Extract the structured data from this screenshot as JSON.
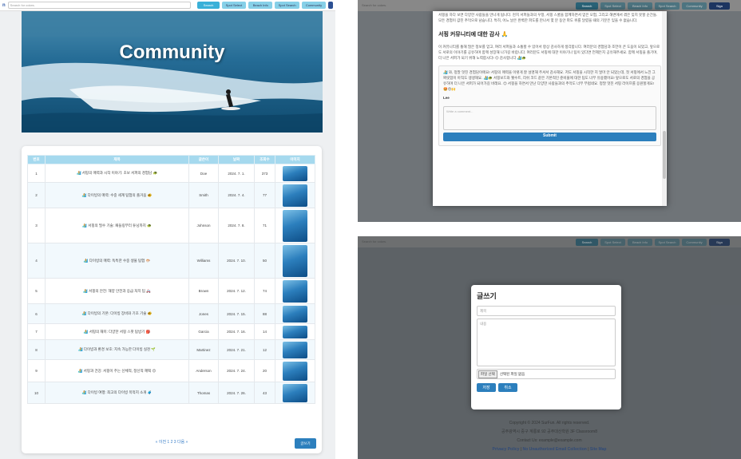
{
  "nav": {
    "brand": "n",
    "search_placeholder": "Search for cokes.",
    "buttons": [
      "Search",
      "Spot Select",
      "Beach Info",
      "Spot Search",
      "Community",
      "Sign"
    ]
  },
  "hero": {
    "title": "Community"
  },
  "table": {
    "headers": [
      "번호",
      "제목",
      "글쓴이",
      "날짜",
      "조회수",
      "이미지"
    ],
    "rows": [
      {
        "no": "1",
        "title": "🏄 서핑의 매력과 시작 이야기: 초보 서퍼의 경험담 🐢",
        "author": "Doe",
        "date": "2024. 7. 1.",
        "views": "373"
      },
      {
        "no": "2",
        "title": "🏄 다이빙의 매력: 수중 세계 탐험의 즐거움 🐠",
        "author": "Smith",
        "date": "2024. 7. 4.",
        "views": "77"
      },
      {
        "no": "3",
        "title": "🏄 서핑의 필수 기술: 패들링부터 튜닝까지 🐢",
        "author": "Johnson",
        "date": "2024. 7. 8.",
        "views": "71"
      },
      {
        "no": "4",
        "title": "🏄 다이빙의 매력: 독특한 수중 생물 탐험 🐡",
        "author": "Williams",
        "date": "2024. 7. 10.",
        "views": "50"
      },
      {
        "no": "5",
        "title": "🏄 서핑의 안전: 해양 안전과 응급 처치 팁 🚑",
        "author": "Brown",
        "date": "2024. 7. 12.",
        "views": "74"
      },
      {
        "no": "6",
        "title": "🏄 다이빙의 기본: 다이빙 장비와 기초 기술 🐠",
        "author": "Jones",
        "date": "2024. 7. 15.",
        "views": "88"
      },
      {
        "no": "7",
        "title": "🏄 서핑의 재미: 다양한 서핑 스팟 탐방기 🎒",
        "author": "Garcia",
        "date": "2024. 7. 16.",
        "views": "14"
      },
      {
        "no": "8",
        "title": "🏄 다이빙과 환경 보호: 지속 가능한 다이빙 실천 🌱",
        "author": "Martinez",
        "date": "2024. 7. 21.",
        "views": "12"
      },
      {
        "no": "9",
        "title": "🏄 서핑과 건강: 서핑이 주는 신체적, 정신적 혜택 😊",
        "author": "Anderson",
        "date": "2024. 7. 24.",
        "views": "20"
      },
      {
        "no": "10",
        "title": "🏄 다이빙 여행: 최고의 다이빙 목적지 소개 🧳",
        "author": "Thomas",
        "date": "2024. 7. 26.",
        "views": "43"
      }
    ]
  },
  "pager": {
    "text": "« 이전  1  2  3  다음 »"
  },
  "write_button": "글쓰기",
  "detail": {
    "intro": "서핑을 하다 보면 다양한 사람들을 만나게 됩니다. 현지 서퍼들과의 우정, 서핑 스쿨을 함께하면서 얻은 모험, 그리고 해변에서 겪은 잊지 못할 순간들. 모든 경험이 값진 추억으로 남습니다. 특히, 어느 날은 완벽한 파도를 만나서 몇 분 동안 파도 위를 달렸을 때의 기분은 잊을 수 없습니다.",
    "heading": "서핑 커뮤니티에 대한 감사 🙏",
    "para": "이 커뮤니티를 통해 많은 정보를 얻고, 여러 서퍼들과 소통할 수 있어서 항상 감사하게 생각합니다. 여러분의 경험담과 조언이 큰 도움이 되었고, 앞으로도 서로의 이야기를 공유하며 함께 성장해 나가길 바랍니다. 여러분도 서핑에 대한 이야기나 팁이 있다면 언제든지 공유해주세요. 함께 서핑을 즐기며, 더 나은 서퍼가 되기 위해 노력합시다! 😊 감사합니다 🏄🐢",
    "comment": "🏄 와, 정말 멋진 경험담이에요! 서핑의 매력을 이렇게 잘 설명해 주셔서 감사해요. 저도 서핑을 시작한 지 얼마 안 되었는데, 첫 서핑에서 느낀 그 짜릿함이 아직도 생생해요. 🏄🐢 서핑보드와 웻수트, 리쉬 코드 같은 기본적인 준비물에 대한 팁도 너무 유용했어요! 앞으로도 서로의 경험을 공유하며 더 나은 서퍼가 되어가길 바래요. 😊 서핑을 하면서 만난 다양한 사람들과의 추억도 너무 부럽네요. 정말 멋진 서핑 라이프를 응원할게요! 🤩😍🙌",
    "author": "Lee",
    "comment_placeholder": "Write a comment...",
    "submit": "Submit"
  },
  "form": {
    "heading": "글쓰기",
    "title_placeholder": "제목",
    "content_placeholder": "내용",
    "file_button": "파일 선택",
    "file_status": "선택된 파일 없음",
    "save": "저장",
    "cancel": "취소"
  },
  "footer": {
    "copyright": "Copyright © 2024 SurFun. All rights reserved.",
    "address": "공주광역시 중구 계룡로 92 공주대산학원 3F Classroom8",
    "contact": "Contact Us: example@example.com",
    "links": [
      "Privacy Policy",
      "No Unauthorized Email Collection",
      "Site Map"
    ]
  }
}
